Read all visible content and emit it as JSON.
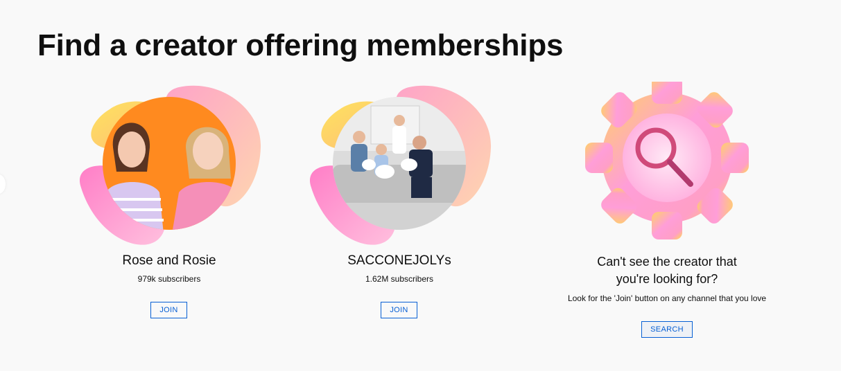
{
  "page": {
    "title": "Find a creator offering memberships"
  },
  "creators": [
    {
      "name": "Rose and Rosie",
      "subscribers": "979k subscribers",
      "button_label": "JOIN"
    },
    {
      "name": "SACCONEJOLYs",
      "subscribers": "1.62M subscribers",
      "button_label": "JOIN"
    }
  ],
  "search_card": {
    "title_line1": "Can't see the creator that",
    "title_line2": "you're looking for?",
    "subtitle": "Look for the 'Join' button on any channel that you love",
    "button_label": "SEARCH",
    "icon": "magnifier-gear-icon"
  },
  "colors": {
    "accent_blue": "#065fd4",
    "background": "#f9f9f9",
    "text": "#0f0f0f"
  }
}
